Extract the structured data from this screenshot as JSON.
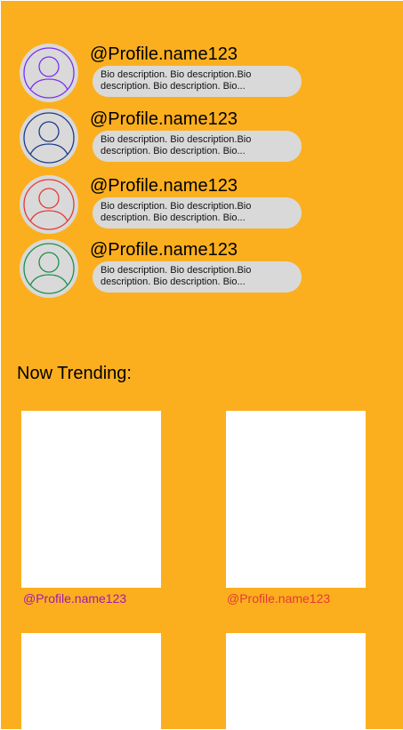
{
  "profiles": [
    {
      "name": "@Profile.name123",
      "bio": "Bio description. Bio description.Bio description. Bio description. Bio...",
      "color": "#7B2FF2"
    },
    {
      "name": "@Profile.name123",
      "bio": "Bio description. Bio description.Bio description. Bio description. Bio...",
      "color": "#1E3A8A"
    },
    {
      "name": "@Profile.name123",
      "bio": "Bio description. Bio description.Bio description. Bio description. Bio...",
      "color": "#E53935"
    },
    {
      "name": "@Profile.name123",
      "bio": "Bio description. Bio description.Bio description. Bio description. Bio...",
      "color": "#1E8E4E"
    }
  ],
  "trending": {
    "title": "Now Trending:",
    "items": [
      {
        "name": "@Profile.name123",
        "color": "#A01BB0"
      },
      {
        "name": "@Profile.name123",
        "color": "#E53935"
      },
      {
        "name": ""
      },
      {
        "name": ""
      }
    ]
  },
  "colors": {
    "background": "#FBAF1F",
    "bio_pill": "#D9D9D9",
    "card": "#FFFFFF"
  }
}
